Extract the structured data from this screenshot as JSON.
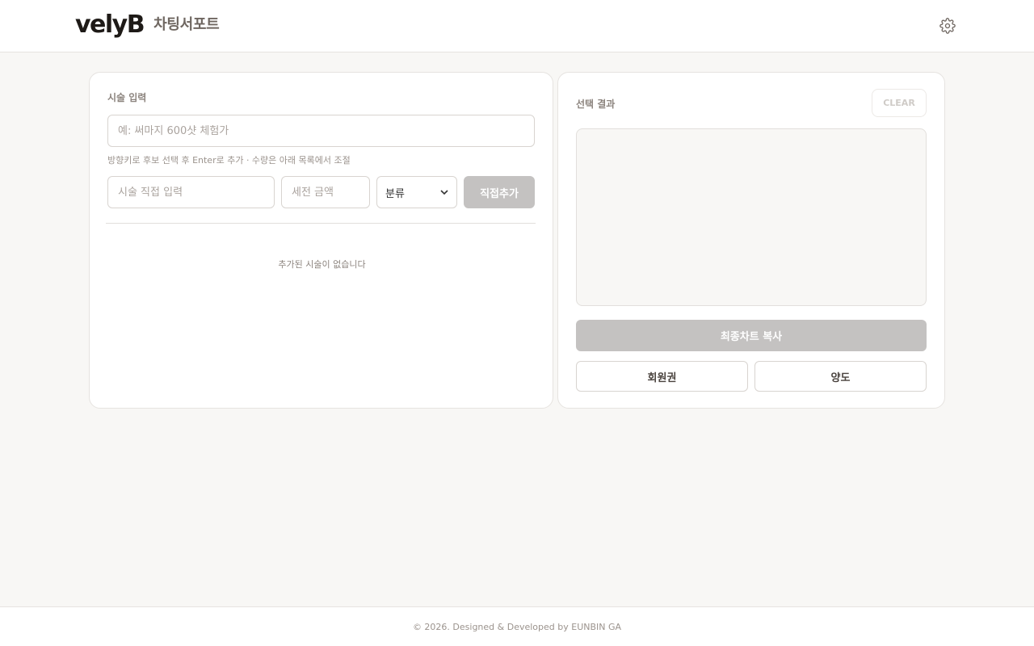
{
  "header": {
    "logo_mark": "velyB",
    "app_title": "차팅서포트",
    "settings_icon": "gear-icon"
  },
  "input_panel": {
    "title": "시술 입력",
    "search_placeholder": "예: 써마지 600샷 체험가",
    "hint": "방향키로 후보 선택 후 Enter로 추가 · 수량은 아래 목록에서 조절",
    "custom_name_placeholder": "시술 직접 입력",
    "custom_price_placeholder": "세전 금액",
    "category_select": "분류",
    "add_button": "직접추가",
    "empty_message": "추가된 시술이 없습니다"
  },
  "result_panel": {
    "title": "선택 결과",
    "clear_button": "CLEAR",
    "copy_button": "최종차트 복사",
    "membership_button": "회원권",
    "transfer_button": "양도"
  },
  "footer": {
    "copyright": "© 2026. Designed & Developed by EUNBIN GA"
  }
}
